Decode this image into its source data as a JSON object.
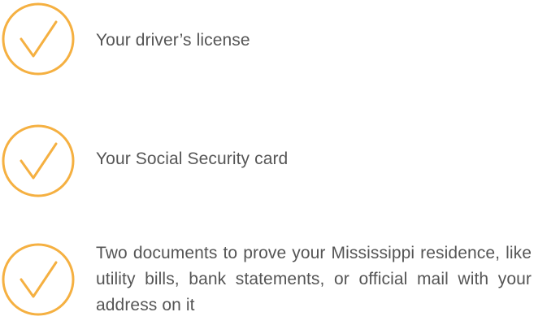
{
  "checklist": {
    "items": [
      {
        "label": "Your driver’s license",
        "icon": "check-circle-icon"
      },
      {
        "label": "Your Social Security card",
        "icon": "check-circle-icon"
      },
      {
        "label": "Two documents to prove your Mississippi residence, like utility bills, bank statements, or official mail with your address on it",
        "icon": "check-circle-icon"
      }
    ]
  },
  "colors": {
    "accent": "#F5B041",
    "text": "#555555",
    "background": "#FFFFFF"
  }
}
